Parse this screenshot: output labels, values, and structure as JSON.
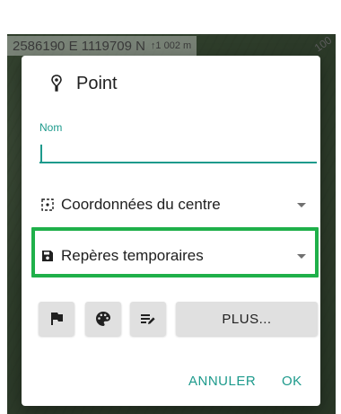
{
  "background": {
    "coords": "2586190 E 1119709 N",
    "altitude": "↑1 002 m",
    "map_label": "100"
  },
  "dialog": {
    "title": "Point",
    "name_label": "Nom",
    "name_value": "",
    "coordinate_mode": "Coordonnées du centre",
    "folder": "Repères temporaires",
    "more_button": "PLUS...",
    "cancel_button": "ANNULER",
    "ok_button": "OK"
  },
  "colors": {
    "accent": "#1d9a8c",
    "highlight": "#1fb04a"
  },
  "icons": {
    "title": "map-pin-icon",
    "coordinate_mode": "crosshair-icon",
    "folder": "save-icon",
    "tools": [
      "flag-icon",
      "palette-icon",
      "edit-note-icon"
    ]
  }
}
